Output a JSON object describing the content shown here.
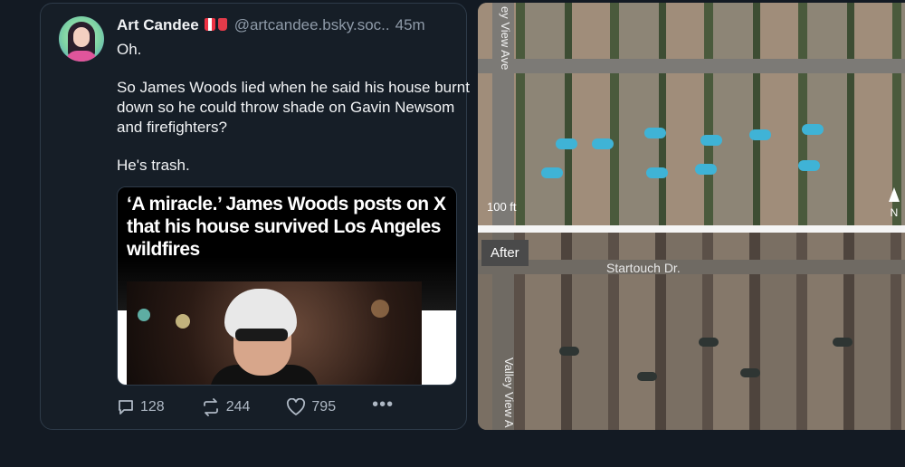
{
  "post": {
    "author_name": "Art Candee",
    "author_emojis": [
      "popcorn-icon",
      "cup-icon"
    ],
    "handle": "@artcandee.bsky.soc..",
    "time": "45m",
    "paragraphs": [
      "Oh.",
      "So James Woods lied when he said his house burnt down so he could throw shade on Gavin Newsom and firefighters?",
      "He's trash."
    ],
    "embed": {
      "headline": "‘A miracle.’ James Woods posts on X that his house survived Los Angeles wildfires"
    },
    "actions": {
      "replies": "128",
      "reposts": "244",
      "likes": "795",
      "more": "•••"
    }
  },
  "image": {
    "scale": "100 ft",
    "north": "N",
    "after_label": "After",
    "street_top": "ey View Ave",
    "street_bottom": "Valley View A",
    "street_horizontal": "Startouch Dr."
  },
  "colors": {
    "background": "#131a23",
    "card": "#161e27",
    "border": "#2e3b49",
    "muted_text": "#8e9aa8",
    "text": "#f1f3f5"
  }
}
